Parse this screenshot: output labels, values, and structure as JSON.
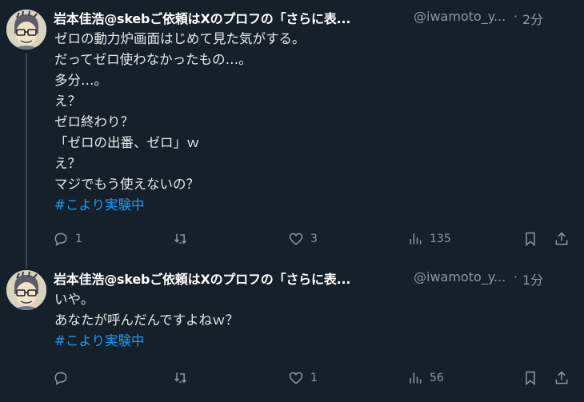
{
  "tweets": [
    {
      "display_name": "岩本佳浩@skebご依頼はXのプロフの「さらに表...",
      "handle": "@iwamoto_y...",
      "separator": "·",
      "time": "2分",
      "more_label": "···",
      "lines": [
        "ゼロの動力炉画面はじめて見た気がする。",
        "だってゼロ使わなかったもの…。",
        "多分…。",
        "え？",
        "ゼロ終わり？",
        "「ゼロの出番、ゼロ」ｗ",
        "え？",
        "マジでもう使えないの？"
      ],
      "hashtag": "#こより実験中",
      "actions": {
        "reply": "1",
        "retweet": "",
        "like": "3",
        "views": "135"
      }
    },
    {
      "display_name": "岩本佳浩@skebご依頼はXのプロフの「さらに表...",
      "handle": "@iwamoto_y...",
      "separator": "·",
      "time": "1分",
      "more_label": "···",
      "lines": [
        "いや。",
        "あなたが呼んだんですよねｗ？"
      ],
      "hashtag": "#こより実験中",
      "actions": {
        "reply": "",
        "retweet": "",
        "like": "1",
        "views": "56"
      }
    }
  ],
  "colors": {
    "background": "#15202b",
    "text": "#e7e9ea",
    "secondary": "#8b98a5",
    "link": "#1d9bf0"
  },
  "icons": [
    "reply-icon",
    "retweet-icon",
    "like-icon",
    "views-icon",
    "bookmark-icon",
    "share-icon"
  ]
}
